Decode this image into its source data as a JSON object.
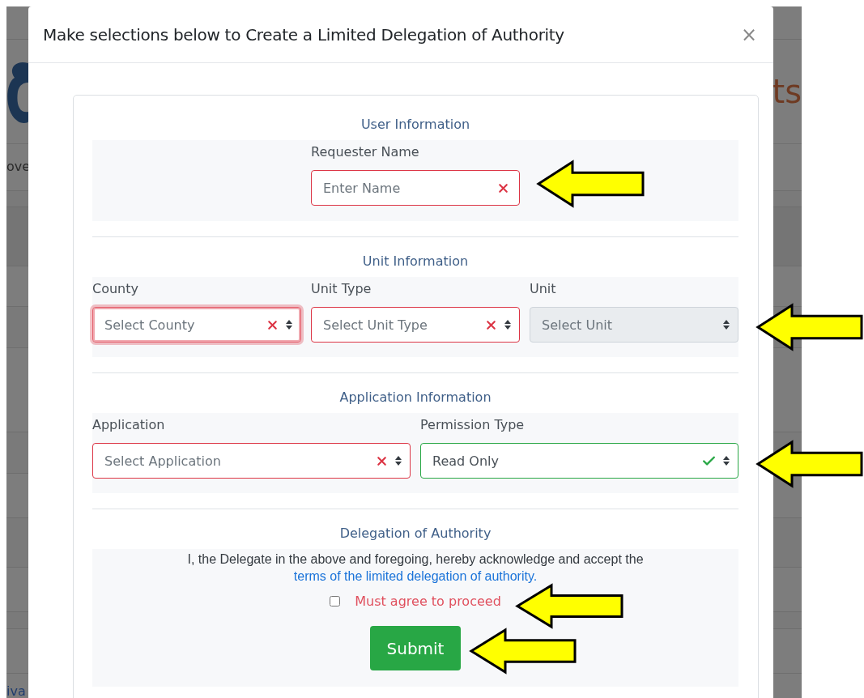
{
  "background": {
    "heading_fragment": "ts",
    "nav_fragment": "ove",
    "footer_link_fragment": "iva"
  },
  "modal": {
    "title": "Make selections below to Create a Limited Delegation of Authority",
    "close": "×"
  },
  "sections": [
    {
      "title": "User Information",
      "fields": [
        {
          "label": "Requester Name",
          "kind": "text",
          "placeholder": "Enter Name",
          "invalid": true,
          "valid": false,
          "focused": false,
          "disabled": false
        }
      ]
    },
    {
      "title": "Unit Information",
      "fields": [
        {
          "label": "County",
          "kind": "select",
          "placeholder": "Select County",
          "invalid": true,
          "valid": false,
          "focused": true,
          "disabled": false
        },
        {
          "label": "Unit Type",
          "kind": "select",
          "placeholder": "Select Unit Type",
          "invalid": true,
          "valid": false,
          "focused": false,
          "disabled": false
        },
        {
          "label": "Unit",
          "kind": "select",
          "placeholder": "Select Unit",
          "invalid": false,
          "valid": false,
          "focused": false,
          "disabled": true
        }
      ]
    },
    {
      "title": "Application Information",
      "fields": [
        {
          "label": "Application",
          "kind": "select",
          "placeholder": "Select Application",
          "invalid": true,
          "valid": false,
          "focused": false,
          "disabled": false
        },
        {
          "label": "Permission Type",
          "kind": "select",
          "value": "Read Only",
          "invalid": false,
          "valid": true,
          "focused": false,
          "disabled": false
        }
      ]
    }
  ],
  "delegation": {
    "title": "Delegation of Authority",
    "statement": "I, the Delegate in the above and foregoing, hereby acknowledge and accept the",
    "link": "terms of the limited delegation of authority.",
    "agreement": {
      "label": "Must agree to proceed",
      "checked": false,
      "invalid": true
    },
    "submit": "Submit"
  }
}
